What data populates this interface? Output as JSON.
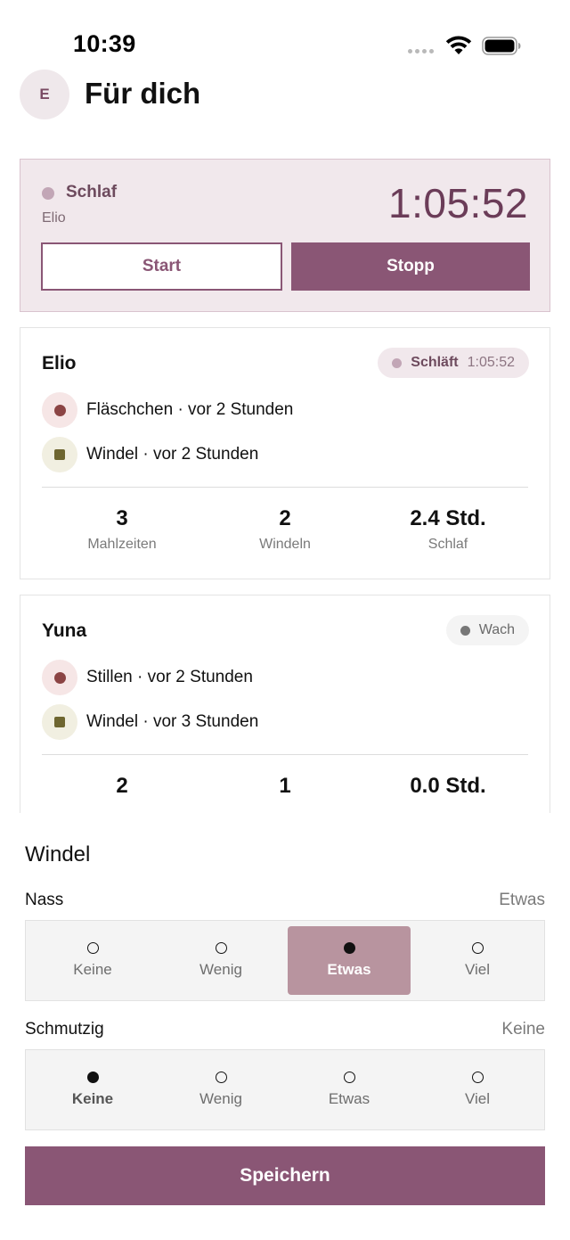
{
  "status_bar": {
    "time": "10:39"
  },
  "header": {
    "avatar_initial": "E",
    "title": "Für dich"
  },
  "timer": {
    "activity": "Schlaf",
    "child": "Elio",
    "elapsed": "1:05:52",
    "start_label": "Start",
    "stop_label": "Stopp"
  },
  "children": [
    {
      "name": "Elio",
      "state": "Schläft",
      "state_time": "1:05:52",
      "events": [
        {
          "icon": "bottle-icon",
          "text": "Fläschchen · vor 2 Stunden"
        },
        {
          "icon": "diaper-icon",
          "text": "Windel · vor 2 Stunden"
        }
      ],
      "stats": [
        {
          "value": "3",
          "label": "Mahlzeiten"
        },
        {
          "value": "2",
          "label": "Windeln"
        },
        {
          "value": "2.4 Std.",
          "label": "Schlaf"
        }
      ]
    },
    {
      "name": "Yuna",
      "state": "Wach",
      "events": [
        {
          "icon": "breastfeeding-icon",
          "text": "Stillen · vor 2 Stunden"
        },
        {
          "icon": "diaper-icon",
          "text": "Windel · vor 3 Stunden"
        }
      ],
      "stats": [
        {
          "value": "2"
        },
        {
          "value": "1"
        },
        {
          "value": "0.0 Std."
        }
      ]
    }
  ],
  "sheet": {
    "title": "Windel",
    "wet": {
      "label": "Nass",
      "value": "Etwas",
      "options": [
        "Keine",
        "Wenig",
        "Etwas",
        "Viel"
      ],
      "selected": "Etwas"
    },
    "dirty": {
      "label": "Schmutzig",
      "value": "Keine",
      "options": [
        "Keine",
        "Wenig",
        "Etwas",
        "Viel"
      ],
      "selected": "Keine"
    },
    "save_label": "Speichern"
  },
  "colors": {
    "accent": "#8a5675",
    "accent_light": "#f1e8ec",
    "selected_segment": "#b8949f",
    "bottle_dot": "#8b4444",
    "diaper_square": "#6e6630",
    "sleep_dot": "#c2a6b6",
    "awake_dot": "#777777"
  }
}
